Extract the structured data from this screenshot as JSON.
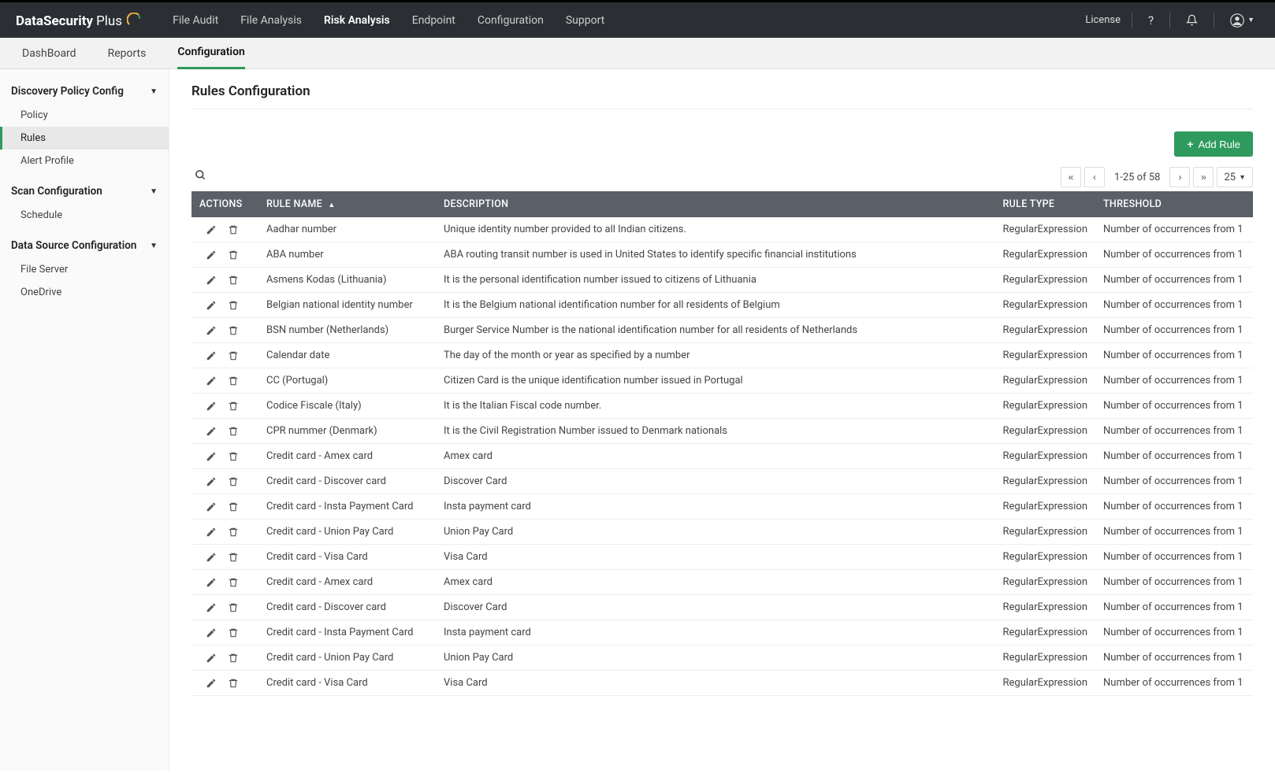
{
  "brand": {
    "bold": "DataSecurity",
    "light": "Plus"
  },
  "topnav": {
    "items": [
      {
        "label": "File Audit"
      },
      {
        "label": "File Analysis"
      },
      {
        "label": "Risk Analysis",
        "active": true
      },
      {
        "label": "Endpoint"
      },
      {
        "label": "Configuration"
      },
      {
        "label": "Support"
      }
    ],
    "license": "License"
  },
  "subnav": {
    "items": [
      {
        "label": "DashBoard"
      },
      {
        "label": "Reports"
      },
      {
        "label": "Configuration",
        "active": true
      }
    ]
  },
  "sidebar": {
    "sections": [
      {
        "title": "Discovery Policy Config",
        "items": [
          {
            "label": "Policy"
          },
          {
            "label": "Rules",
            "active": true
          },
          {
            "label": "Alert Profile"
          }
        ]
      },
      {
        "title": "Scan Configuration",
        "items": [
          {
            "label": "Schedule"
          }
        ]
      },
      {
        "title": "Data Source Configuration",
        "items": [
          {
            "label": "File Server"
          },
          {
            "label": "OneDrive"
          }
        ]
      }
    ]
  },
  "page": {
    "title": "Rules Configuration",
    "addButton": "Add Rule",
    "pagination": {
      "range": "1-25 of 58",
      "pageSize": "25"
    },
    "columns": {
      "actions": "ACTIONS",
      "name": "RULE NAME",
      "description": "DESCRIPTION",
      "type": "RULE TYPE",
      "threshold": "THRESHOLD"
    },
    "rows": [
      {
        "name": "Aadhar number",
        "desc": "Unique identity number provided to all Indian citizens.",
        "type": "RegularExpression",
        "threshold": "Number of occurrences from 1"
      },
      {
        "name": "ABA number",
        "desc": "ABA routing transit number is used in United States to identify specific financial institutions",
        "type": "RegularExpression",
        "threshold": "Number of occurrences from 1"
      },
      {
        "name": "Asmens Kodas (Lithuania)",
        "desc": "It is the personal identification number issued to citizens of Lithuania",
        "type": "RegularExpression",
        "threshold": "Number of occurrences from 1"
      },
      {
        "name": "Belgian national identity number",
        "desc": "It is the Belgium national identification number for all residents of Belgium",
        "type": "RegularExpression",
        "threshold": "Number of occurrences from 1"
      },
      {
        "name": "BSN number (Netherlands)",
        "desc": "Burger Service Number is the national identification number for all residents of Netherlands",
        "type": "RegularExpression",
        "threshold": "Number of occurrences from 1"
      },
      {
        "name": "Calendar date",
        "desc": "The day of the month or year as specified by a number",
        "type": "RegularExpression",
        "threshold": "Number of occurrences from 1"
      },
      {
        "name": "CC (Portugal)",
        "desc": "Citizen Card is the unique identification number issued in Portugal",
        "type": "RegularExpression",
        "threshold": "Number of occurrences from 1"
      },
      {
        "name": "Codice Fiscale (Italy)",
        "desc": "It is the Italian Fiscal code number.",
        "type": "RegularExpression",
        "threshold": "Number of occurrences from 1"
      },
      {
        "name": "CPR nummer (Denmark)",
        "desc": "It is the Civil Registration Number issued to Denmark nationals",
        "type": "RegularExpression",
        "threshold": "Number of occurrences from 1"
      },
      {
        "name": "Credit card - Amex card",
        "desc": "Amex card",
        "type": "RegularExpression",
        "threshold": "Number of occurrences from 1"
      },
      {
        "name": "Credit card - Discover card",
        "desc": "Discover Card",
        "type": "RegularExpression",
        "threshold": "Number of occurrences from 1"
      },
      {
        "name": "Credit card - Insta Payment Card",
        "desc": "Insta payment card",
        "type": "RegularExpression",
        "threshold": "Number of occurrences from 1"
      },
      {
        "name": "Credit card - Union Pay Card",
        "desc": "Union Pay Card",
        "type": "RegularExpression",
        "threshold": "Number of occurrences from 1"
      },
      {
        "name": "Credit card - Visa Card",
        "desc": "Visa Card",
        "type": "RegularExpression",
        "threshold": "Number of occurrences from 1"
      },
      {
        "name": "Credit card - Amex card",
        "desc": "Amex card",
        "type": "RegularExpression",
        "threshold": "Number of occurrences from 1"
      },
      {
        "name": "Credit card - Discover card",
        "desc": "Discover Card",
        "type": "RegularExpression",
        "threshold": "Number of occurrences from 1"
      },
      {
        "name": "Credit card - Insta Payment Card",
        "desc": "Insta payment card",
        "type": "RegularExpression",
        "threshold": "Number of occurrences from 1"
      },
      {
        "name": "Credit card - Union Pay Card",
        "desc": "Union Pay Card",
        "type": "RegularExpression",
        "threshold": "Number of occurrences from 1"
      },
      {
        "name": "Credit card - Visa Card",
        "desc": "Visa Card",
        "type": "RegularExpression",
        "threshold": "Number of occurrences from 1"
      }
    ]
  }
}
